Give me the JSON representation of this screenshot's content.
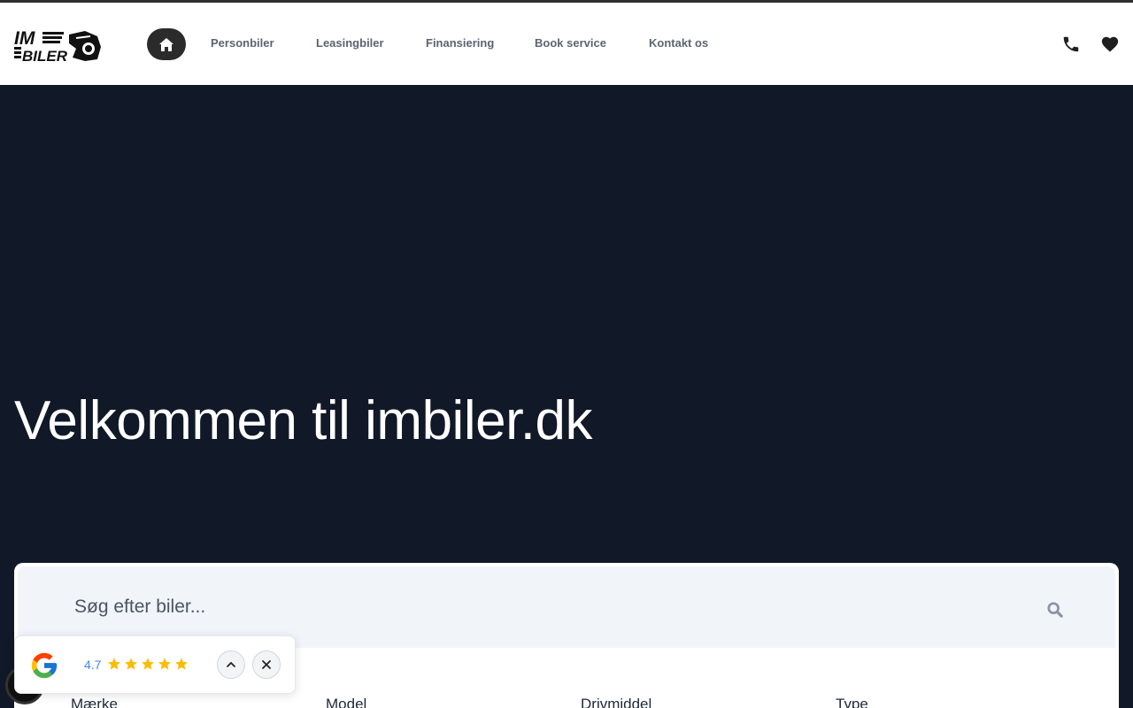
{
  "header": {
    "logo_text_top": "IM",
    "logo_text_bottom": "BILER",
    "nav": [
      {
        "label": "Personbiler"
      },
      {
        "label": "Leasingbiler"
      },
      {
        "label": "Finansiering"
      },
      {
        "label": "Book service"
      },
      {
        "label": "Kontakt os"
      }
    ],
    "icons": [
      "home-icon",
      "phone-icon",
      "heart-icon"
    ]
  },
  "hero": {
    "title": "Velkommen til imbiler.dk"
  },
  "search": {
    "placeholder": "Søg efter biler...",
    "value": "",
    "filters": [
      {
        "label": "Mærke"
      },
      {
        "label": "Model"
      },
      {
        "label": "Drivmiddel"
      },
      {
        "label": "Type"
      }
    ]
  },
  "review": {
    "rating": "4.7",
    "stars": 5,
    "star_color": "#fbbc04"
  },
  "colors": {
    "hero_bg": "#111827",
    "header_bg": "#ffffff",
    "nav_text": "#5b6472",
    "home_btn": "#2b2b2b",
    "search_bg": "#f1f4f9"
  }
}
